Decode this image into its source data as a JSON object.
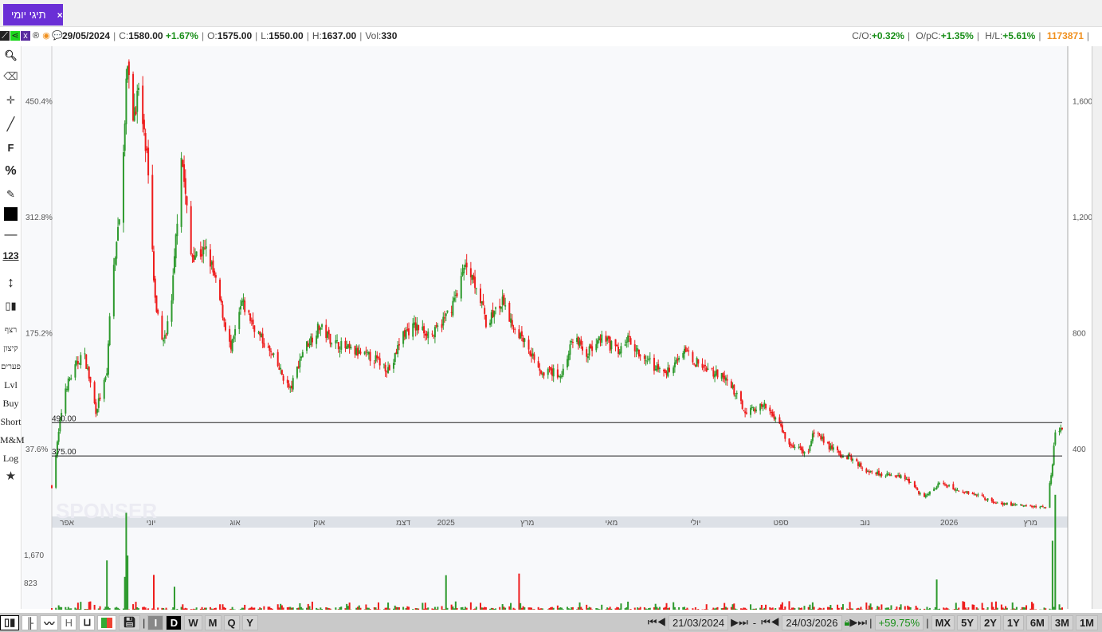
{
  "tab": {
    "label": "תיגי יומי",
    "close": "×"
  },
  "info": {
    "date": "29/05/2024",
    "c_label": "C:",
    "close": "1580.00",
    "change": "+1.67%",
    "o_label": "O:",
    "open": "1575.00",
    "l_label": "L:",
    "low": "1550.00",
    "h_label": "H:",
    "high": "1637.00",
    "vol_label": "Vol:",
    "vol": "330",
    "co_label": "C/O:",
    "co": "+0.32%",
    "opc_label": "O/pC:",
    "opc": "+1.35%",
    "hl_label": "H/L:",
    "hl": "+5.61%",
    "id": "1173871"
  },
  "toolbar": {
    "f": "F",
    "pct": "%",
    "num": "123",
    "seq": "רצף",
    "extreme": "קיצון",
    "gaps": "פערים",
    "lvl": "Lvl",
    "buy": "Buy",
    "short": "Short",
    "mm": "M&M",
    "log": "Log"
  },
  "bottom": {
    "h": "H",
    "i": "I",
    "d": "D",
    "w": "W",
    "m": "M",
    "q": "Q",
    "y": "Y",
    "start": "21/03/2024",
    "dash": "-",
    "end": "24/03/2026",
    "perf": "+59.75%",
    "ranges": [
      "MX",
      "5Y",
      "2Y",
      "1Y",
      "6M",
      "3M",
      "1M"
    ]
  },
  "colors": {
    "up": "#2e9a2e",
    "down": "#ee1c1c",
    "accent": "#6a2fd6",
    "orange": "#f0901e"
  },
  "chart_data": {
    "type": "candlestick",
    "price_axis": {
      "ticks": [
        400,
        800,
        1200,
        1600
      ],
      "labels": [
        "400",
        "800",
        "1,200",
        "1,600"
      ]
    },
    "pct_axis": {
      "labels": [
        "37.6%",
        "175.2%",
        "312.8%",
        "450.4%"
      ]
    },
    "levels": [
      {
        "value": 490,
        "label": "490.00"
      },
      {
        "value": 375,
        "label": "375.00"
      }
    ],
    "volume_axis": {
      "labels": [
        "823",
        "1,670"
      ],
      "ticks": [
        823,
        1670
      ]
    },
    "months": [
      {
        "label": "אפר",
        "day": 11
      },
      {
        "label": "יוני",
        "day": 72
      },
      {
        "label": "אוג",
        "day": 133
      },
      {
        "label": "אוק",
        "day": 194
      },
      {
        "label": "דצמ",
        "day": 255
      },
      {
        "label": "2025",
        "day": 286
      },
      {
        "label": "מרץ",
        "day": 345
      },
      {
        "label": "מאי",
        "day": 406
      },
      {
        "label": "יולי",
        "day": 467
      },
      {
        "label": "ספט",
        "day": 529
      },
      {
        "label": "נוב",
        "day": 590
      },
      {
        "label": "2026",
        "day": 651
      },
      {
        "label": "מרץ",
        "day": 710
      }
    ],
    "total_days": 733,
    "close_path": [
      271,
      600,
      738,
      532,
      656,
      958,
      1178,
      1728,
      1535,
      1632,
      1398,
      903,
      766,
      903,
      1425,
      1068,
      1082,
      931,
      738,
      903,
      794,
      711,
      601,
      738,
      821,
      766,
      738,
      711,
      670,
      794,
      821,
      794,
      876,
      1041,
      958,
      835,
      903,
      848,
      766,
      670,
      656,
      794,
      725,
      780,
      738,
      780,
      711,
      656,
      738,
      697,
      656,
      629,
      532,
      546,
      505,
      422,
      381,
      463,
      408,
      381,
      367,
      326,
      312,
      298,
      230,
      285,
      257,
      243,
      216,
      207,
      199,
      202,
      353,
      463
    ],
    "close_path_day": [
      0,
      9,
      23,
      32,
      40,
      43,
      49,
      55,
      58,
      63,
      69,
      75,
      81,
      87,
      94,
      101,
      113,
      121,
      130,
      138,
      150,
      161,
      173,
      182,
      194,
      205,
      217,
      234,
      246,
      254,
      263,
      277,
      289,
      301,
      309,
      315,
      327,
      332,
      344,
      355,
      370,
      379,
      387,
      399,
      410,
      419,
      430,
      445,
      457,
      468,
      483,
      491,
      503,
      517,
      526,
      534,
      549,
      553,
      564,
      572,
      581,
      590,
      604,
      619,
      633,
      645,
      656,
      671,
      683,
      697,
      715,
      722,
      726,
      728
    ],
    "volume_spikes": [
      {
        "day": 23,
        "v": 1250
      },
      {
        "day": 40,
        "v": 1500
      },
      {
        "day": 53,
        "v": 1000
      },
      {
        "day": 54,
        "v": 2950
      },
      {
        "day": 55,
        "v": 1650
      },
      {
        "day": 57,
        "v": 1900
      },
      {
        "day": 74,
        "v": 1060
      },
      {
        "day": 86,
        "v": 1900
      },
      {
        "day": 89,
        "v": 700
      },
      {
        "day": 197,
        "v": 600
      },
      {
        "day": 286,
        "v": 1050
      },
      {
        "day": 339,
        "v": 1100
      },
      {
        "day": 642,
        "v": 920
      },
      {
        "day": 726,
        "v": 2100
      },
      {
        "day": 728,
        "v": 3500
      }
    ]
  }
}
